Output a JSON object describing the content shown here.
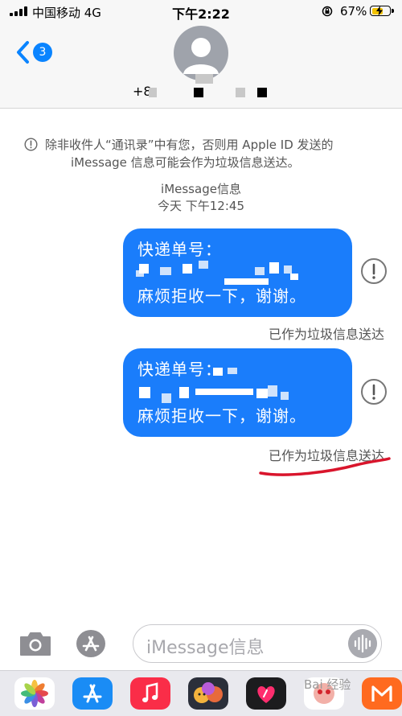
{
  "status_bar": {
    "carrier": "中国移动 4G",
    "time": "下午2:22",
    "battery_percent": "67%",
    "battery_level": 0.67
  },
  "header": {
    "unread_count": "3",
    "contact_prefix": "+8"
  },
  "conversation": {
    "notice": {
      "line1": "除非收件人“通讯录”中有您，否则用 Apple ID 发送的",
      "line2": "iMessage 信息可能会作为垃圾信息送达。"
    },
    "service_label": "iMessage信息",
    "timestamp": "今天 下午12:45",
    "messages": [
      {
        "line1": "快递单号：",
        "line3": "麻烦拒收一下，谢谢。",
        "status": "已作为垃圾信息送达"
      },
      {
        "line1": "快递单号：",
        "line3": "麻烦拒收一下，谢谢。",
        "status": "已作为垃圾信息送达"
      }
    ]
  },
  "composer": {
    "placeholder": "iMessage信息"
  },
  "app_drawer": {
    "apps": [
      "photos-icon",
      "app-store-icon",
      "music-icon",
      "memoji-icon",
      "digital-touch-icon",
      "red-envelope-app-icon",
      "orange-app-icon"
    ],
    "watermark": "Bai 经验"
  },
  "colors": {
    "bubble": "#1a7dfb",
    "accent": "#0a84ff",
    "underline": "#d9152c"
  }
}
